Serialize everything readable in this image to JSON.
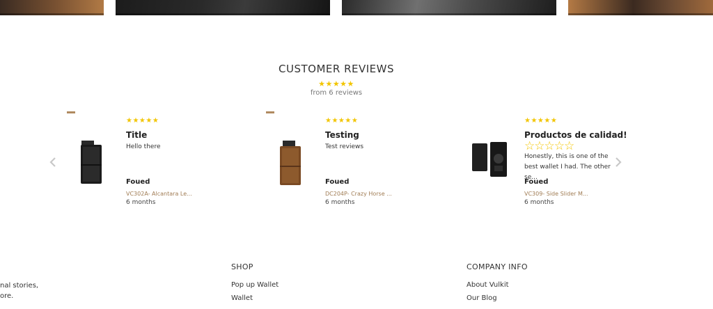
{
  "reviews": {
    "title": "CUSTOMER REVIEWS",
    "summary_stars": "★★★★★",
    "summary_count": "from 6 reviews",
    "items": [
      {
        "stars": "★★★★★",
        "title": "Title",
        "body": "Hello there",
        "author": "Foued",
        "product": "VC302A- Alcantara Le...",
        "time": "6 months",
        "product_color": "black"
      },
      {
        "stars": "★★★★★",
        "title": "Testing",
        "body": "Test reviews",
        "author": "Foued",
        "product": "DC204P- Crazy Horse ...",
        "time": "6 months",
        "product_color": "brown"
      },
      {
        "stars": "★★★★★",
        "title": "Productos de calidad!",
        "inline_stars": "☆☆☆☆☆",
        "body": "Honestly, this is one of the best wallet I had. The other se...",
        "author": "Foued",
        "product": "VC309- Side Slider M...",
        "time": "6 months",
        "product_color": "black"
      }
    ]
  },
  "footer": {
    "about_text_line1": "nal stories,",
    "about_text_line2": "ore.",
    "shop": {
      "heading": "SHOP",
      "links": [
        "Pop up Wallet",
        "Wallet"
      ]
    },
    "company": {
      "heading": "COMPANY INFO",
      "links": [
        "About Vulkit",
        "Our Blog"
      ]
    }
  },
  "colors": {
    "star": "#f2c500",
    "product_link": "#a07c54"
  }
}
